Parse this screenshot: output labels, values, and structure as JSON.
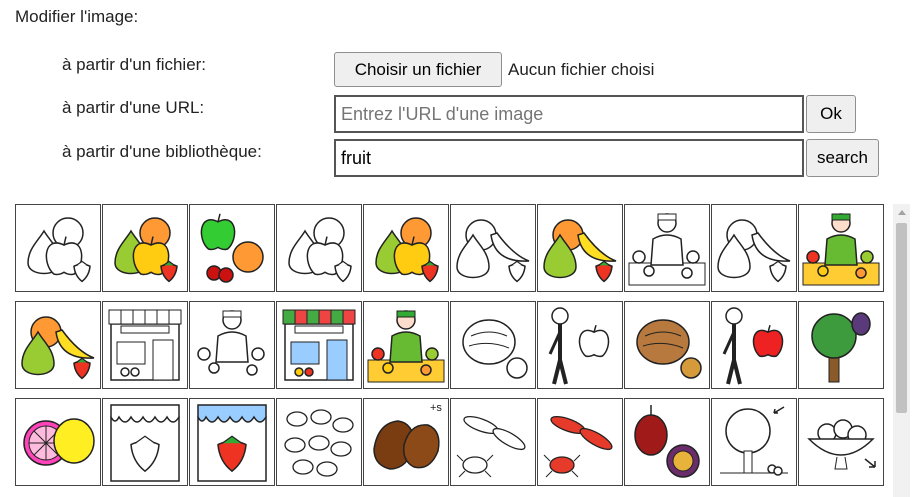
{
  "page": {
    "title": "Modifier l'image:"
  },
  "from_file": {
    "label": "à partir d'un fichier:",
    "button": "Choisir un fichier",
    "status": "Aucun fichier choisi"
  },
  "from_url": {
    "label": "à partir d'une URL:",
    "placeholder": "Entrez l'URL d'une image",
    "value": "",
    "button": "Ok"
  },
  "from_library": {
    "label": "à partir d'une bibliothèque:",
    "value": "fruit",
    "button": "search"
  },
  "results": {
    "rows": [
      [
        "fruit-outline-icon",
        "fruit-color-icon",
        "apple-orange-cherry-icon",
        "fruit-outline-icon",
        "fruit-color-icon",
        "fruit-banana-outline-icon",
        "fruit-banana-color-icon",
        "greengrocer-outline-icon",
        "fruit-banana-outline-icon",
        "greengrocer-color-icon"
      ],
      [
        "fruit-banana-color-icon",
        "fruit-shop-outline-icon",
        "greengrocer-woman-outline-icon",
        "fruit-shop-color-icon",
        "greengrocer-woman-color-icon",
        "walnut-outline-icon",
        "person-apple-outline-icon",
        "walnut-color-icon",
        "person-apple-color-icon",
        "fruit-tree-icon"
      ],
      [
        "citrus-slice-icon",
        "strawberry-outline-icon",
        "strawberry-color-icon",
        "nuts-outline-icon",
        "chestnut-plural-icon",
        "seafood-outline-icon",
        "seafood-color-icon",
        "exotic-fruit-icon",
        "fruit-tree-outline-icon",
        "fruit-bowl-outline-icon"
      ]
    ]
  }
}
